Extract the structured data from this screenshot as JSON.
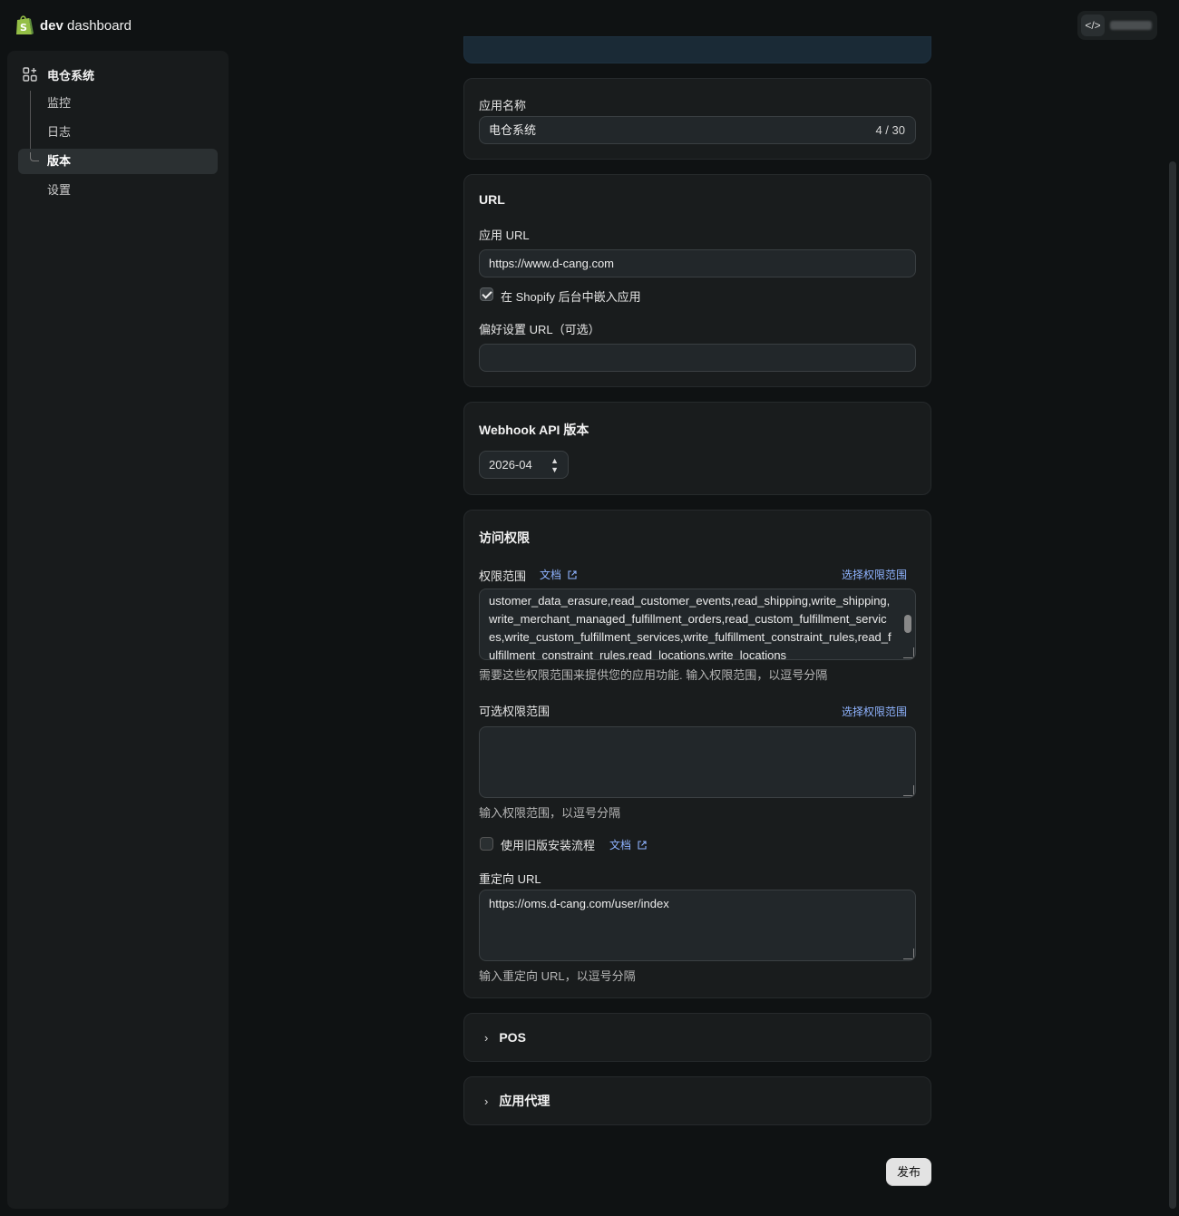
{
  "header": {
    "brand_bold": "dev",
    "brand_rest": "dashboard"
  },
  "sidebar": {
    "app_name": "电仓系统",
    "items": [
      {
        "label": "监控"
      },
      {
        "label": "日志"
      },
      {
        "label": "版本"
      },
      {
        "label": "设置"
      }
    ]
  },
  "app_name_card": {
    "label": "应用名称",
    "value": "电仓系统",
    "counter": "4 / 30"
  },
  "url_card": {
    "title": "URL",
    "app_url_label": "应用 URL",
    "app_url_value": "https://www.d-cang.com",
    "embed_label": "在 Shopify 后台中嵌入应用",
    "pref_url_label": "偏好设置 URL（可选）",
    "pref_url_value": ""
  },
  "webhook_card": {
    "title": "Webhook API 版本",
    "version": "2026-04"
  },
  "access_card": {
    "title": "访问权限",
    "scopes_label": "权限范围",
    "docs_link": "文档",
    "select_scopes": "选择权限范围",
    "scopes_value": "ustomer_data_erasure,read_customer_events,read_shipping,write_shipping,write_merchant_managed_fulfillment_orders,read_custom_fulfillment_services,write_custom_fulfillment_services,write_fulfillment_constraint_rules,read_fulfillment_constraint_rules,read_locations,write_locations",
    "scopes_hint": "需要这些权限范围来提供您的应用功能. 输入权限范围，以逗号分隔",
    "optional_label": "可选权限范围",
    "optional_select": "选择权限范围",
    "optional_hint": "输入权限范围，以逗号分隔",
    "legacy_label": "使用旧版安装流程",
    "legacy_docs": "文档",
    "redirect_label": "重定向 URL",
    "redirect_value": "https://oms.d-cang.com/user/index",
    "redirect_hint": "输入重定向 URL，以逗号分隔"
  },
  "pos_card": {
    "title": "POS"
  },
  "proxy_card": {
    "title": "应用代理"
  },
  "publish_button": "发布"
}
